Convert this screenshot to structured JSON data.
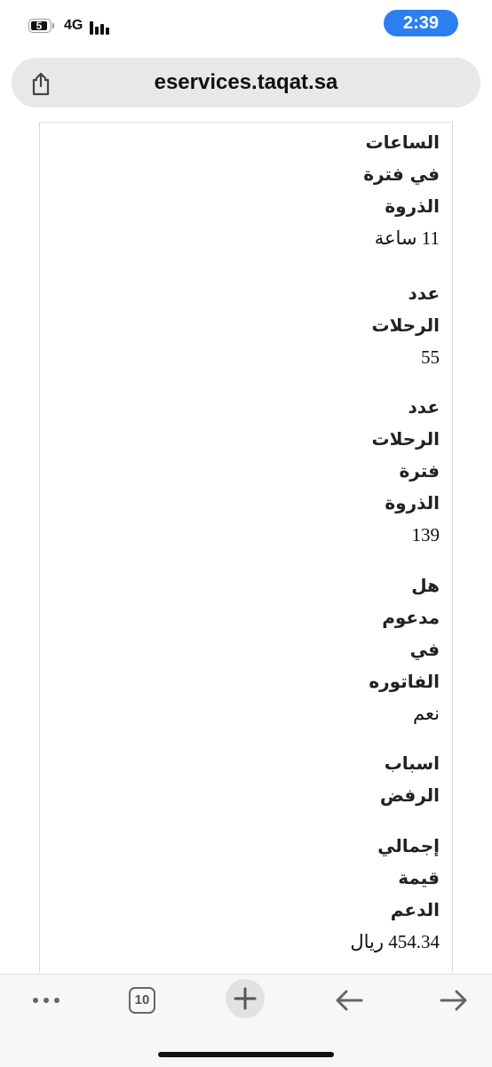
{
  "status_bar": {
    "battery_level": "5",
    "network": "4G",
    "signal_strength": "4 of 4 bars",
    "time": "2:39"
  },
  "address_bar": {
    "url": "eservices.taqat.sa",
    "share_icon": "share-icon"
  },
  "fields": [
    {
      "label_lines": [
        "الساعات",
        "في فترة",
        "الذروة"
      ],
      "value": "11 ساعة"
    },
    {
      "label_lines": [
        "عدد",
        "الرحلات"
      ],
      "value": "55"
    },
    {
      "label_lines": [
        "عدد",
        "الرحلات",
        "فترة",
        "الذروة"
      ],
      "value": "139"
    },
    {
      "label_lines": [
        "هل",
        "مدعوم",
        "في",
        "الفاتوره"
      ],
      "value": "نعم"
    },
    {
      "label_lines": [
        "اسباب",
        "الرفض"
      ],
      "value": ""
    },
    {
      "label_lines": [
        "إجمالي",
        "قيمة",
        "الدعم"
      ],
      "value": "454.34 ريال"
    }
  ],
  "toolbar": {
    "more_icon": "ellipsis-icon",
    "tab_count": "10",
    "new_tab_icon": "plus-icon",
    "back_icon": "arrow-left-icon",
    "forward_icon": "arrow-right-icon"
  },
  "colors": {
    "time_pill": "#2d7ff0",
    "address_bar_bg": "#e8e8ea",
    "toolbar_bg": "#f7f7f8"
  }
}
